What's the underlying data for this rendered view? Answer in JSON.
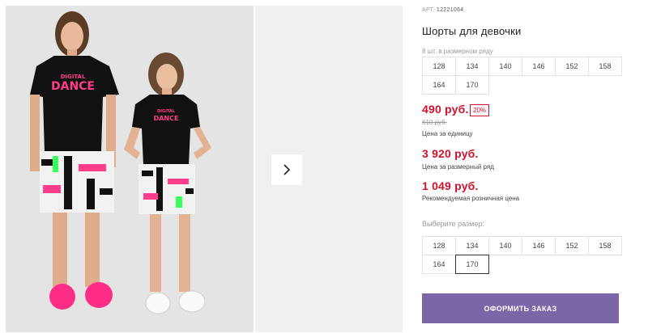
{
  "gallery": {
    "next_icon": "chevron-right-icon",
    "main_photo": {
      "adult_shirt_text": [
        "DIGITAL",
        "DANCE"
      ],
      "child_shirt_text": [
        "DIGITAL",
        "DANCE"
      ]
    }
  },
  "product": {
    "article_label": "АРТ.",
    "article_value": "12221064",
    "title": "Шорты для девочки",
    "pack_note": "8 шт. в размерном ряду",
    "pack_sizes": [
      "128",
      "134",
      "140",
      "146",
      "152",
      "158",
      "164",
      "170"
    ],
    "price": "490 руб.",
    "discount": "20%",
    "old_price": "610 руб.",
    "price_caption": "Цена за единицу",
    "pack_price": "3 920 руб.",
    "pack_price_caption": "Цена за размерный ряд",
    "retail_price": "1 049 руб.",
    "retail_price_caption": "Рекомендуемая розничная цена",
    "choose_size_label": "Выберите размер:",
    "size_options": [
      "128",
      "134",
      "140",
      "146",
      "152",
      "158",
      "164",
      "170"
    ],
    "selected_size": "170",
    "order_button": "ОФОРМИТЬ ЗАКАЗ"
  },
  "colors": {
    "price_red": "#d0112b",
    "button_purple": "#7b66a8",
    "neon_pink": "#ff3d8b",
    "neon_green": "#39ff5a"
  }
}
